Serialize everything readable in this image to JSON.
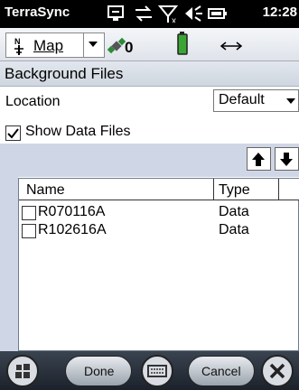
{
  "status_bar": {
    "app_name": "TerraSync",
    "time": "12:28",
    "icons": [
      "sync-icon",
      "network-icon",
      "no-signal-icon",
      "volume-icon",
      "battery-icon"
    ]
  },
  "toolbar": {
    "view_label": "Map",
    "satellite_count": "0",
    "icons": [
      "north-arrow-icon",
      "satellite-icon",
      "battery-status-icon",
      "horizontal-arrows-icon"
    ]
  },
  "section": {
    "title": "Background Files"
  },
  "location": {
    "label": "Location",
    "value": "Default"
  },
  "show_data_files": {
    "label": "Show Data Files",
    "checked": true
  },
  "file_list": {
    "columns": [
      "Name",
      "Type"
    ],
    "rows": [
      {
        "name": "R070116A",
        "type": "Data",
        "checked": false
      },
      {
        "name": "R102616A",
        "type": "Data",
        "checked": false
      }
    ]
  },
  "bottom_bar": {
    "done_label": "Done",
    "cancel_label": "Cancel",
    "icons": [
      "windows-start-icon",
      "keyboard-icon",
      "close-icon"
    ]
  },
  "colors": {
    "status_bar_bg": "#000000",
    "section_header_bg": "#d6dce5",
    "list_band_bg": "#cfd7e6",
    "bottom_bar_bg": "#2a323d"
  }
}
